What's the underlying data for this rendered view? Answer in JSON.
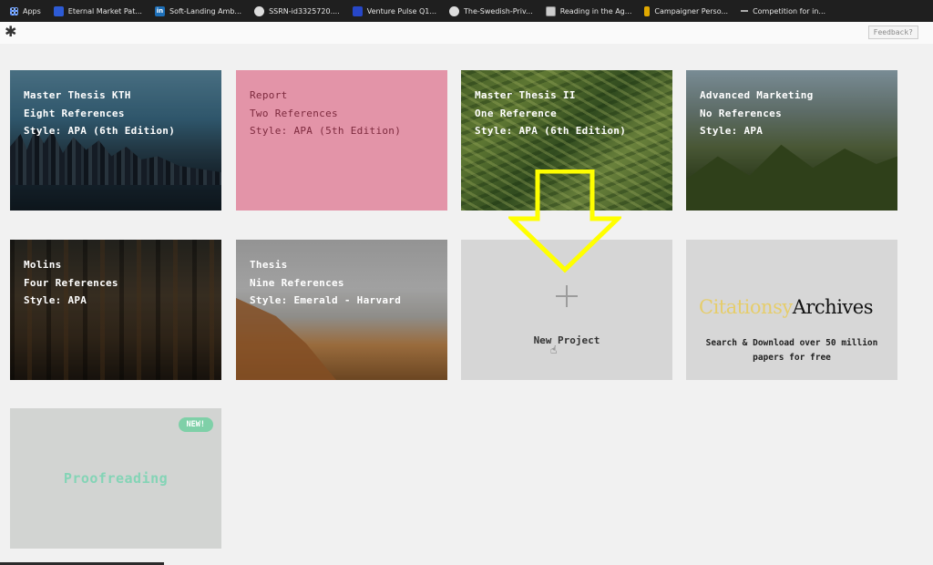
{
  "bookmarks": [
    {
      "label": "Apps",
      "icon": "apps-grid-icon"
    },
    {
      "label": "Eternal Market Pat...",
      "icon": "blue-square-icon"
    },
    {
      "label": "Soft-Landing Amb...",
      "icon": "linkedin-icon"
    },
    {
      "label": "SSRN-id3325720....",
      "icon": "globe-icon"
    },
    {
      "label": "Venture Pulse Q1...",
      "icon": "vp-icon"
    },
    {
      "label": "The-Swedish-Priv...",
      "icon": "globe-icon"
    },
    {
      "label": "Reading in the Ag...",
      "icon": "image-icon"
    },
    {
      "label": "Campaigner Perso...",
      "icon": "bookmark-icon"
    },
    {
      "label": "Competition for in...",
      "icon": "dash-icon"
    }
  ],
  "header": {
    "logo": "✱",
    "feedback_label": "Feedback?"
  },
  "projects": [
    {
      "line1": "Master Thesis KTH",
      "line2": "Eight References",
      "line3": "Style: APA (6th Edition)"
    },
    {
      "line1": "Report",
      "line2": "Two References",
      "line3": "Style: APA (5th Edition)"
    },
    {
      "line1": "Master Thesis II",
      "line2": "One Reference",
      "line3": "Style: APA (6th Edition)"
    },
    {
      "line1": "Advanced Marketing",
      "line2": "No References",
      "line3": "Style: APA"
    },
    {
      "line1": "Molins",
      "line2": "Four References",
      "line3": "Style: APA"
    },
    {
      "line1": "Thesis",
      "line2": "Nine References",
      "line3": "Style: Emerald - Harvard"
    }
  ],
  "new_project": {
    "label": "New Project"
  },
  "citationsy": {
    "logo_part1": "Citationsy",
    "logo_part2": "Archives",
    "description": "Search & Download over 50 million papers for free"
  },
  "proofreading": {
    "badge": "NEW!",
    "label": "Proofreading"
  },
  "colors": {
    "arrow": "#ffff00",
    "report_card": "#e394a8",
    "proofreading_text": "#84d4b6"
  }
}
